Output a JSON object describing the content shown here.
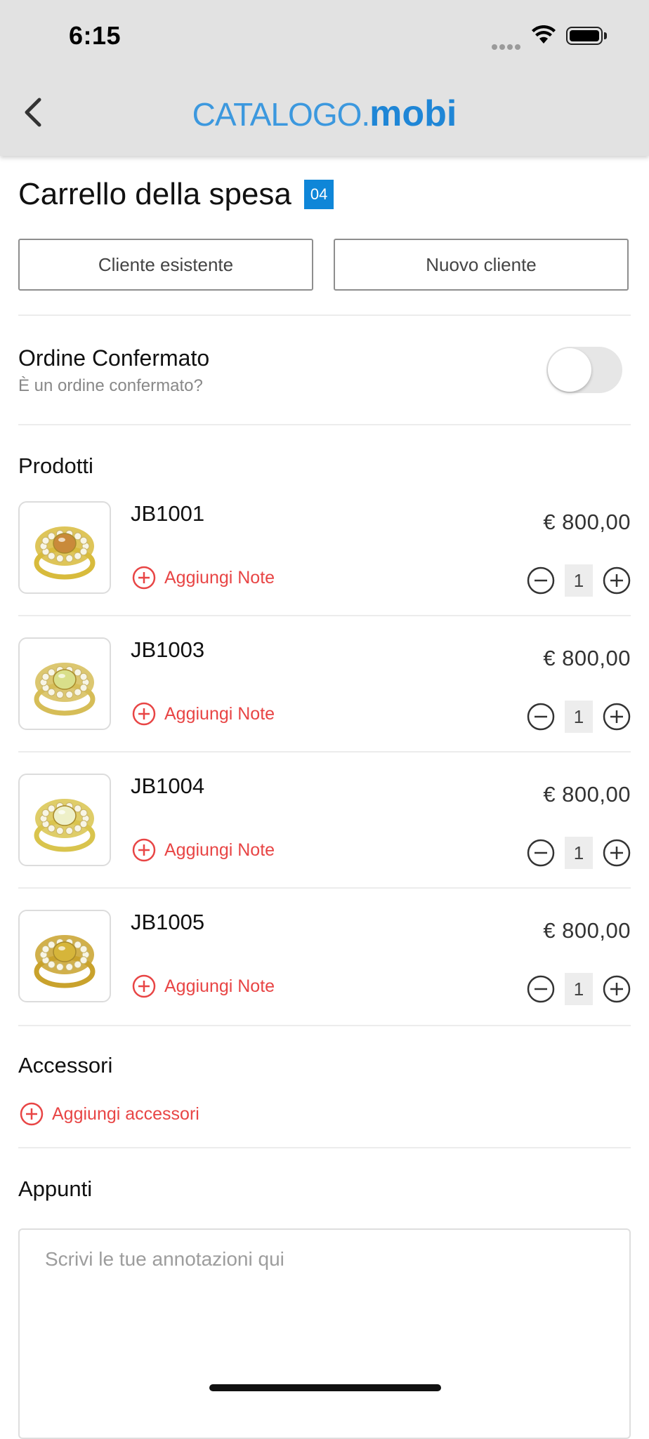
{
  "status_bar": {
    "time": "6:15"
  },
  "nav": {
    "logo_part1": "CATALOGO.",
    "logo_part2": "mobi",
    "back_icon": "chevron-left-icon"
  },
  "cart": {
    "title": "Carrello della spesa",
    "count_badge": "04",
    "existing_client_label": "Cliente esistente",
    "new_client_label": "Nuovo cliente"
  },
  "order": {
    "label": "Ordine Confermato",
    "sublabel": "È un ordine confermato?",
    "confirmed": false
  },
  "products_section": {
    "title": "Prodotti"
  },
  "products": [
    {
      "code": "JB1001",
      "price": "€ 800,00",
      "note_label": "Aggiungi Note",
      "qty": "1",
      "colors": {
        "stone": "#c98a3a",
        "metal": "#d8bb3c"
      }
    },
    {
      "code": "JB1003",
      "price": "€ 800,00",
      "note_label": "Aggiungi Note",
      "qty": "1",
      "colors": {
        "stone": "#d9df8a",
        "metal": "#d6bd57"
      }
    },
    {
      "code": "JB1004",
      "price": "€ 800,00",
      "note_label": "Aggiungi Note",
      "qty": "1",
      "colors": {
        "stone": "#eef0c8",
        "metal": "#d9c44d"
      }
    },
    {
      "code": "JB1005",
      "price": "€ 800,00",
      "note_label": "Aggiungi Note",
      "qty": "1",
      "colors": {
        "stone": "#d6b53a",
        "metal": "#c9a22c"
      }
    }
  ],
  "accessories": {
    "title": "Accessori",
    "add_label": "Aggiungi accessori"
  },
  "notes": {
    "title": "Appunti",
    "placeholder": "Scrivi le tue annotazioni qui"
  },
  "colors": {
    "brand_blue": "#1f86d6",
    "badge_blue": "#0f86d8",
    "action_red": "#e84545"
  }
}
